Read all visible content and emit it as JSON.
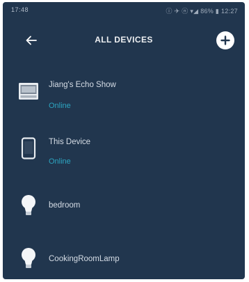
{
  "status_bar": {
    "time_left": "17:48",
    "right_info": "ⓘ ✈ ⓝ ▾◢ 86% ▮ 12:27"
  },
  "header": {
    "title": "ALL DEVICES",
    "back_icon": "arrow-left-icon",
    "add_icon": "plus-circle-icon"
  },
  "devices": [
    {
      "name": "Jiang's Echo Show",
      "status": "Online",
      "icon": "echo-show-icon"
    },
    {
      "name": "This Device",
      "status": "Online",
      "icon": "phone-device-icon"
    },
    {
      "name": "bedroom",
      "status": "",
      "icon": "light-bulb-icon"
    },
    {
      "name": "CookingRoomLamp",
      "status": "",
      "icon": "light-bulb-icon"
    }
  ],
  "colors": {
    "background": "#21364e",
    "status_online": "#2fb8d4",
    "text": "#d6dde6"
  }
}
